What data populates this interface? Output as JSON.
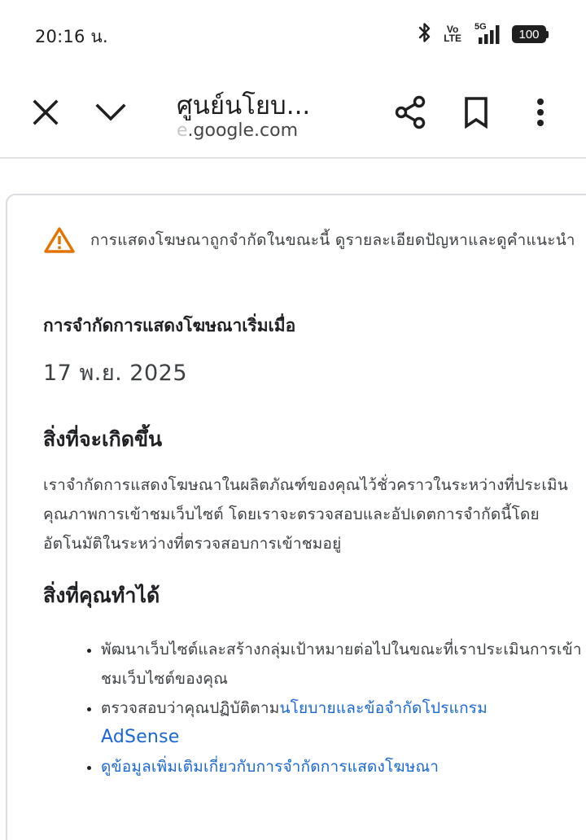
{
  "status_bar": {
    "time": "20:16 น.",
    "volte_top": "Vo",
    "volte_bottom": "LTE",
    "network": "5G",
    "battery": "100"
  },
  "toolbar": {
    "title": "ศูนย์นโยบ...",
    "url_faded": "e",
    "url": ".google.com",
    "icons": [
      "close-icon",
      "chevron-down-icon",
      "share-icon",
      "bookmark-icon",
      "more-vert-icon"
    ]
  },
  "card": {
    "warning": "การแสดงโฆษณาถูกจำกัดในขณะนี้ ดูรายละเอียดปัญหาและดูคำแนะนำ",
    "start_label": "การจำกัดการแสดงโฆษณาเริ่มเมื่อ",
    "start_date": "17 พ.ย. 2025",
    "what_heading": "สิ่งที่จะเกิดขึ้น",
    "what_text": "เราจำกัดการแสดงโฆษณาในผลิตภัณฑ์ของคุณไว้ชั่วคราวในระหว่างที่ประเมินคุณภาพการเข้าชมเว็บไซต์ โดยเราจะตรวจสอบและอัปเดตการจำกัดนี้โดยอัตโนมัติในระหว่างที่ตรวจสอบการเข้าชมอยู่",
    "cando_heading": "สิ่งที่คุณทำได้",
    "item1": "พัฒนาเว็บไซต์และสร้างกลุ่มเป้าหมายต่อไปในขณะที่เราประเมินการเข้าชมเว็บไซต์ของคุณ",
    "item2_prefix": "ตรวจสอบว่าคุณปฏิบัติตาม",
    "item2_link": "นโยบายและข้อจำกัดโปรแกรม",
    "item2_link_brand": "AdSense",
    "item3_link": "ดูข้อมูลเพิ่มเติมเกี่ยวกับการจำกัดการแสดงโฆษณา"
  },
  "colors": {
    "warning": "#e37400",
    "link": "#1967d2",
    "text": "#3c4043"
  }
}
